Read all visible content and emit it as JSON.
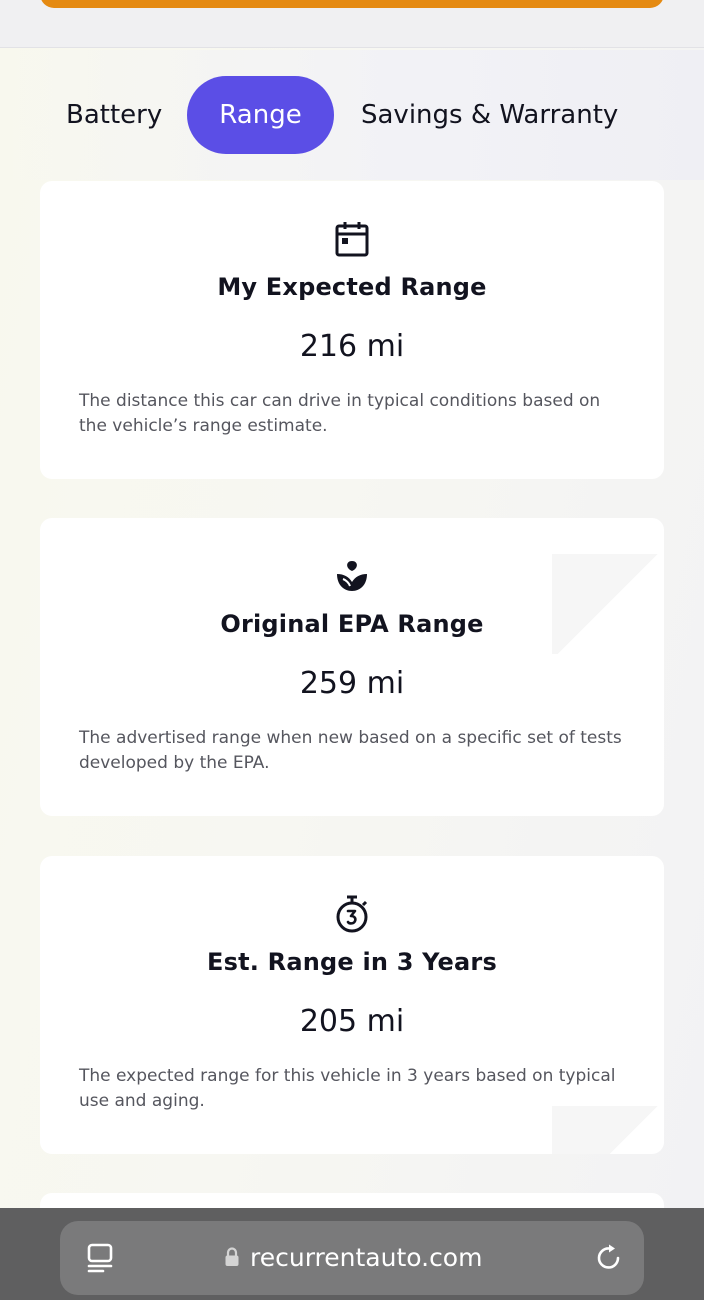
{
  "tabs": [
    {
      "label": "Battery",
      "active": false
    },
    {
      "label": "Range",
      "active": true
    },
    {
      "label": "Savings & Warranty",
      "active": false
    }
  ],
  "cards": [
    {
      "icon": "calendar-icon",
      "title": "My Expected Range",
      "value": "216 mi",
      "description": "The distance this car can drive in typical conditions based on the vehicle’s range estimate."
    },
    {
      "icon": "leaf-plant-icon",
      "title": "Original EPA Range",
      "value": "259 mi",
      "description": "The advertised range when new based on a specific set of tests developed by the EPA."
    },
    {
      "icon": "timer-3-icon",
      "title": "Est. Range in 3 Years",
      "value": "205 mi",
      "description": "The expected range for this vehicle in 3 years based on typical use and aging."
    }
  ],
  "browser": {
    "url": "recurrentauto.com",
    "reader_icon": "reader-icon",
    "lock_icon": "lock-icon",
    "reload_icon": "reload-icon"
  },
  "colors": {
    "accent": "#5b4ee6",
    "orange": "#e58a12",
    "text": "#12131f",
    "muted": "#55565e"
  }
}
